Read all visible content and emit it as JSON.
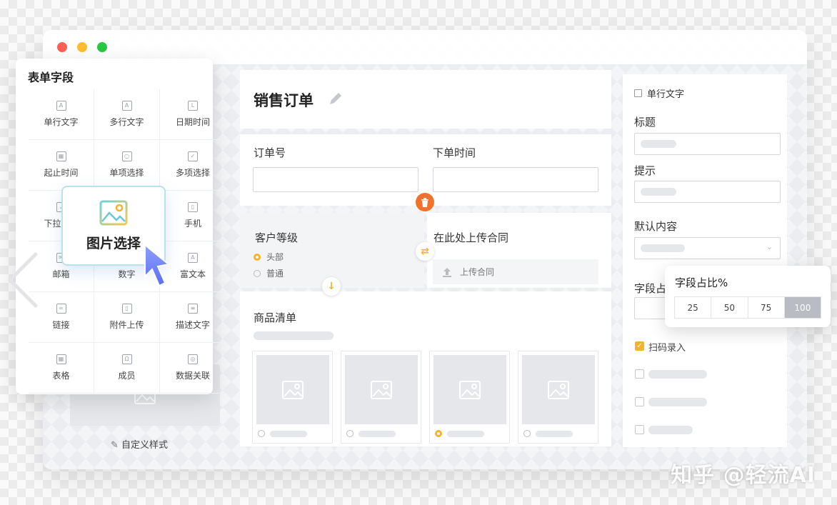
{
  "palette": {
    "title": "表单字段",
    "items": [
      {
        "label": "单行文字",
        "icon": "text-line-icon"
      },
      {
        "label": "多行文字",
        "icon": "text-multi-icon"
      },
      {
        "label": "日期时间",
        "icon": "calendar-icon"
      },
      {
        "label": "起止时间",
        "icon": "date-range-icon"
      },
      {
        "label": "单项选择",
        "icon": "radio-icon"
      },
      {
        "label": "多项选择",
        "icon": "checkbox-icon"
      },
      {
        "label": "下拉选择",
        "icon": "dropdown-icon"
      },
      {
        "label": "",
        "icon": ""
      },
      {
        "label": "手机",
        "icon": "phone-icon"
      },
      {
        "label": "邮箱",
        "icon": "mail-icon"
      },
      {
        "label": "数字",
        "icon": "number-icon"
      },
      {
        "label": "富文本",
        "icon": "rich-text-icon"
      },
      {
        "label": "链接",
        "icon": "link-icon"
      },
      {
        "label": "附件上传",
        "icon": "attachment-icon"
      },
      {
        "label": "描述文字",
        "icon": "description-icon"
      },
      {
        "label": "表格",
        "icon": "table-icon"
      },
      {
        "label": "成员",
        "icon": "member-icon"
      },
      {
        "label": "数据关联",
        "icon": "data-link-icon"
      }
    ],
    "dragging_label": "图片选择",
    "custom_style": "自定义样式"
  },
  "form": {
    "title": "销售订单",
    "order_no_label": "订单号",
    "order_time_label": "下单时间",
    "customer_level_label": "客户等级",
    "customer_levels": [
      {
        "label": "头部",
        "selected": true
      },
      {
        "label": "普通",
        "selected": false
      }
    ],
    "upload_label": "在此处上传合同",
    "upload_button": "上传合同",
    "product_list_label": "商品清单",
    "product_selected_index": 2
  },
  "props": {
    "header": "单行文字",
    "title_label": "标题",
    "hint_label": "提示",
    "default_label": "默认内容",
    "ratio_label_partial": "字段占",
    "scan_label": "扫码录入"
  },
  "ratio_popover": {
    "title": "字段占比%",
    "options": [
      "25",
      "50",
      "75",
      "100"
    ],
    "selected": "100"
  },
  "watermark": "知乎 @轻流AI",
  "colors": {
    "accent": "#f5b32b",
    "delete": "#f2712c",
    "close_dot": "#fe5f57",
    "min_dot": "#febc2e",
    "max_dot": "#28c840"
  }
}
